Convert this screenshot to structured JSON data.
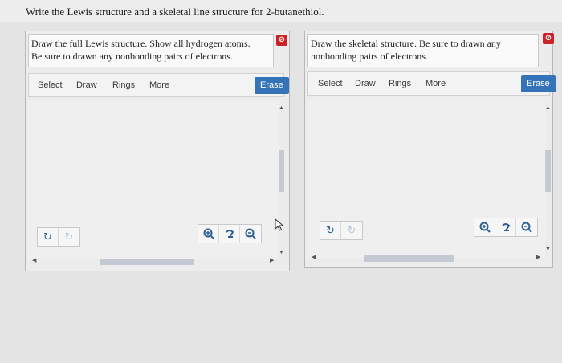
{
  "question": "Write the Lewis structure and a skeletal line structure for 2-butanethiol.",
  "panels": [
    {
      "instruction_line1": "Draw the full Lewis structure. Show all hydrogen atoms.",
      "instruction_line2": "Be sure to drawn any nonbonding pairs of electrons.",
      "tools": [
        "Select",
        "Draw",
        "Rings",
        "More"
      ],
      "erase_label": "Erase"
    },
    {
      "instruction_line1": "Draw the skeletal structure. Be sure to drawn any",
      "instruction_line2": "nonbonding pairs of electrons.",
      "tools": [
        "Select",
        "Draw",
        "Rings",
        "More"
      ],
      "erase_label": "Erase"
    }
  ],
  "icons": {
    "badge": "error-badge-icon",
    "undo": "undo-icon",
    "redo": "redo-icon",
    "zoom_in": "zoom-in-icon",
    "reset": "reset-zoom-icon",
    "zoom_out": "zoom-out-icon"
  },
  "colors": {
    "accent": "#3573b8",
    "badge": "#cc2227",
    "scroll_thumb": "#c5c9d4"
  }
}
